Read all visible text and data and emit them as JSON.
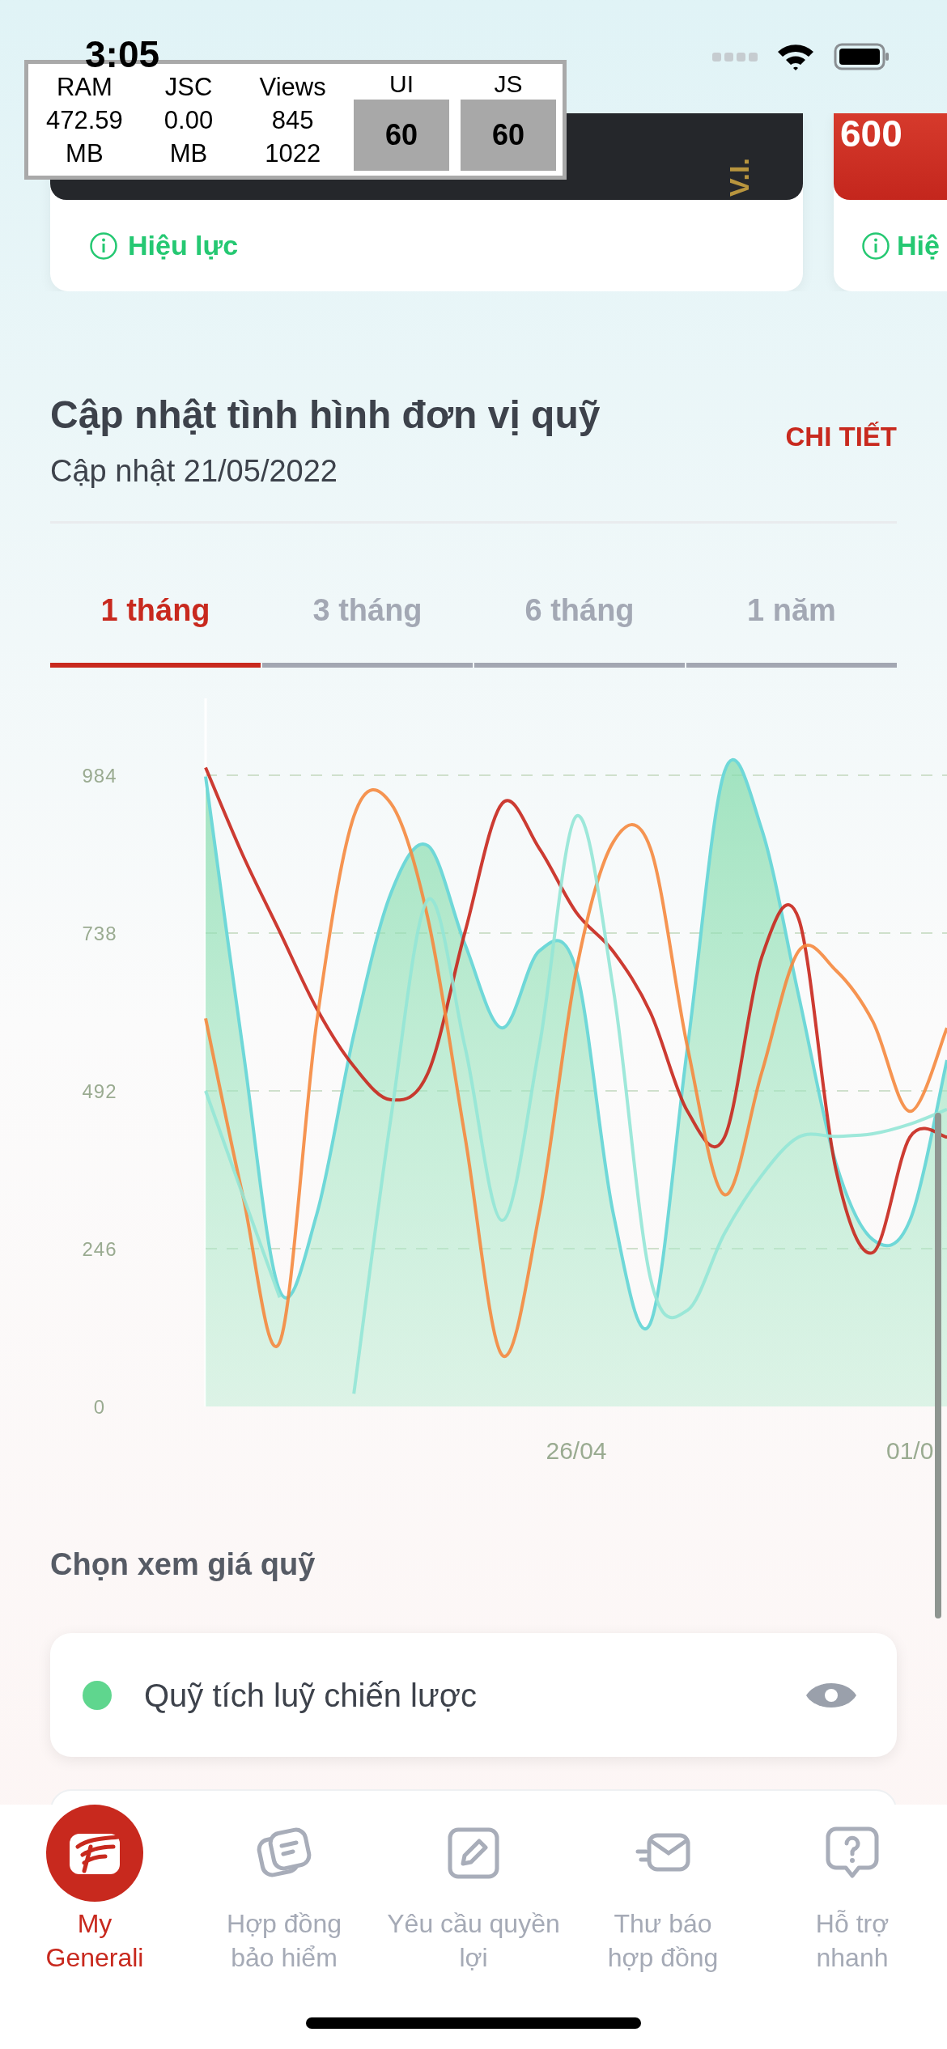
{
  "status_bar": {
    "time": "3:05"
  },
  "perf_monitor": {
    "stats": [
      {
        "label": "RAM",
        "lines": [
          "472.59",
          "MB"
        ]
      },
      {
        "label": "JSC",
        "lines": [
          "0.00",
          "MB"
        ]
      },
      {
        "label": "Views",
        "lines": [
          "845",
          "1022"
        ]
      }
    ],
    "fps": [
      {
        "label": "UI",
        "value": "60"
      },
      {
        "label": "JS",
        "value": "60"
      }
    ]
  },
  "cards": [
    {
      "kind": "vip",
      "image_text": "V.I.",
      "status": "Hiệu lực"
    },
    {
      "kind": "red",
      "image_text": "600",
      "status": "Hiệ"
    }
  ],
  "fund_update": {
    "title": "Cập nhật tình hình đơn vị quỹ",
    "subtitle": "Cập nhật 21/05/2022",
    "link": "CHI TIẾT"
  },
  "tabs": [
    {
      "label": "1 tháng",
      "selected": true
    },
    {
      "label": "3 tháng",
      "selected": false
    },
    {
      "label": "6 tháng",
      "selected": false
    },
    {
      "label": "1 năm",
      "selected": false
    }
  ],
  "chart_data": {
    "type": "line",
    "grid": true,
    "categories": [
      null,
      null,
      null,
      null,
      null,
      null,
      null,
      null,
      null,
      null,
      "26/04",
      null,
      null,
      null,
      null,
      null,
      null,
      null,
      null,
      "01/0",
      null
    ],
    "ylim": [
      0,
      1100
    ],
    "yticks": [
      0,
      246,
      492,
      738,
      984
    ],
    "series": [
      {
        "color": "#c8261c",
        "values": [
          996,
          860,
          740,
          620,
          530,
          478,
          520,
          740,
          940,
          870,
          770,
          709,
          614,
          460,
          420,
          700,
          760,
          370,
          240,
          420,
          420
        ]
      },
      {
        "color": "#f5883e",
        "values": [
          605,
          330,
          100,
          600,
          920,
          940,
          760,
          420,
          80,
          300,
          680,
          880,
          870,
          560,
          330,
          520,
          710,
          680,
          600,
          460,
          590
        ]
      },
      {
        "color": "#93e6d6",
        "values": [
          492,
          330,
          170,
          null,
          20,
          450,
          790,
          560,
          290,
          560,
          920,
          650,
          200,
          150,
          270,
          360,
          420,
          421,
          425,
          440,
          463
        ]
      },
      {
        "color": "#6fd8d8",
        "type": "area",
        "values": [
          982,
          560,
          180,
          300,
          580,
          800,
          874,
          720,
          590,
          710,
          680,
          300,
          130,
          560,
          990,
          900,
          640,
          380,
          260,
          290,
          540
        ]
      }
    ]
  },
  "fund_picker": {
    "title": "Chọn xem giá quỹ",
    "items": [
      {
        "name": "Quỹ tích luỹ chiến lược",
        "color": "#5fd68e"
      }
    ]
  },
  "nav": [
    {
      "kind": "home",
      "label_lines": [
        "My",
        "Generali"
      ],
      "selected": true
    },
    {
      "kind": "contracts",
      "label_lines": [
        "Hợp đồng",
        "bảo hiểm"
      ],
      "selected": false
    },
    {
      "kind": "claims",
      "label_lines": [
        "Yêu cầu quyền",
        "lợi"
      ],
      "selected": false
    },
    {
      "kind": "mail",
      "label_lines": [
        "Thư báo",
        "hợp đồng"
      ],
      "selected": false
    },
    {
      "kind": "help",
      "label_lines": [
        "Hỗ trợ",
        "nhanh"
      ],
      "selected": false
    }
  ]
}
